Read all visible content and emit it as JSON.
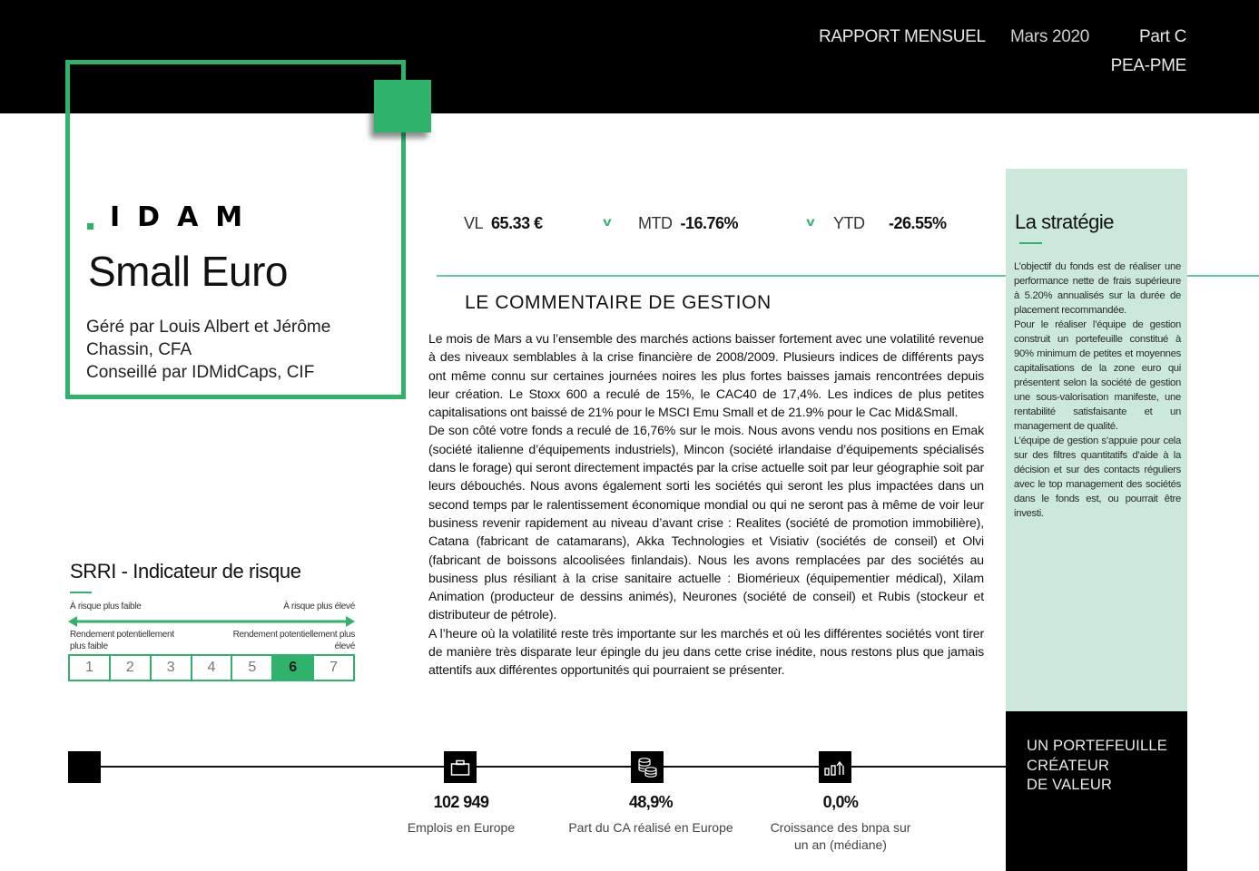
{
  "header": {
    "report": "RAPPORT MENSUEL",
    "date": "Mars 2020",
    "part": "Part C",
    "eligibility": "PEA-PME"
  },
  "colors": {
    "accent": "#2fb36a",
    "strategy_bg": "#cbe8da",
    "dark": "#000000"
  },
  "fund": {
    "brand": "IDAM",
    "name": "Small Euro",
    "managed_by": "Géré par Louis Albert et Jérôme Chassin, CFA",
    "advised_by": "Conseillé par IDMidCaps, CIF"
  },
  "kpis": {
    "vl_label": "VL",
    "vl_value": "65.33 €",
    "mtd_label": "MTD",
    "mtd_value": "-16.76%",
    "mtd_icon": "chevron-down-icon",
    "ytd_label": "YTD",
    "ytd_value": "-26.55%",
    "ytd_icon": "chevron-down-icon"
  },
  "commentary": {
    "title": "LE COMMENTAIRE DE GESTION",
    "paragraphs": [
      "Le mois de Mars a vu l’ensemble des marchés actions baisser fortement avec une volatilité revenue à des niveaux semblables à la crise financière de 2008/2009. Plusieurs indices de différents pays ont même connu sur certaines journées noires les plus fortes baisses jamais rencontrées depuis leur création. Le Stoxx 600 a reculé de 15%, le CAC40 de 17,4%. Les indices de plus petites capitalisations ont baissé de 21% pour le MSCI Emu Small et de 21.9% pour le Cac Mid&Small.",
      "De son côté votre fonds a reculé de 16,76% sur le mois. Nous avons vendu nos positions en Emak (société italienne d’équipements industriels), Mincon (société irlandaise d’équipements spécialisés dans le forage) qui seront directement impactés par la crise actuelle soit par leur géographie soit par leurs débouchés. Nous avons également sorti les sociétés qui seront les plus impactées dans un second temps par le ralentissement économique mondial ou qui ne seront pas à même de voir leur business revenir rapidement au niveau d’avant crise : Realites (société de promotion immobilière), Catana (fabricant de catamarans), Akka Technologies et Visiativ (sociétés de conseil) et Olvi (fabricant de boissons alcoolisées finlandais). Nous les avons remplacées par des sociétés au business plus résiliant à la crise sanitaire actuelle : Biomérieux (équipementier médical), Xilam Animation (producteur de dessins animés), Neurones (société de conseil) et Rubis (stockeur et distributeur de pétrole).",
      "A l’heure où la volatilité reste très importante sur les marchés et où les différentes sociétés vont tirer de manière très disparate leur épingle du jeu dans cette crise inédite, nous restons plus que jamais attentifs aux différentes opportunités qui pourraient se présenter."
    ]
  },
  "strategy": {
    "title": "La stratégie",
    "paragraphs": [
      "L’objectif du fonds est de réaliser une performance nette de frais supérieure à 5.20% annualisés sur la durée de placement recommandée.",
      "Pour le réaliser l’équipe de gestion construit un portefeuille constitué à 90% minimum de petites et moyennes capitalisations de la zone euro qui présentent selon la société de gestion une sous-valorisation manifeste, une rentabilité satisfaisante et un management de qualité.",
      "L’équipe de gestion s’appuie pour cela sur des filtres quantitatifs d’aide à la décision et sur des contacts réguliers avec le top management des sociétés dans le fonds est, ou pourrait être investi."
    ]
  },
  "srri": {
    "title": "SRRI - Indicateur de risque",
    "low_risk": "À risque plus faible",
    "high_risk": "À risque plus élevé",
    "low_return": "Rendement potentiellement plus faible",
    "high_return": "Rendement potentiellement plus élevé",
    "levels": [
      "1",
      "2",
      "3",
      "4",
      "5",
      "6",
      "7"
    ],
    "selected": 6
  },
  "stats": [
    {
      "icon": "briefcase-icon",
      "value": "102 949",
      "label": "Emplois en Europe"
    },
    {
      "icon": "coins-icon",
      "value": "48,9%",
      "label": "Part du CA réalisé en Europe"
    },
    {
      "icon": "growth-chart-icon",
      "value": "0,0%",
      "label": "Croissance des bnpa sur un an (médiane)"
    }
  ],
  "value_box": {
    "line1": "UN PORTEFEUILLE",
    "line2": "CRÉATEUR",
    "line3": "DE VALEUR"
  }
}
